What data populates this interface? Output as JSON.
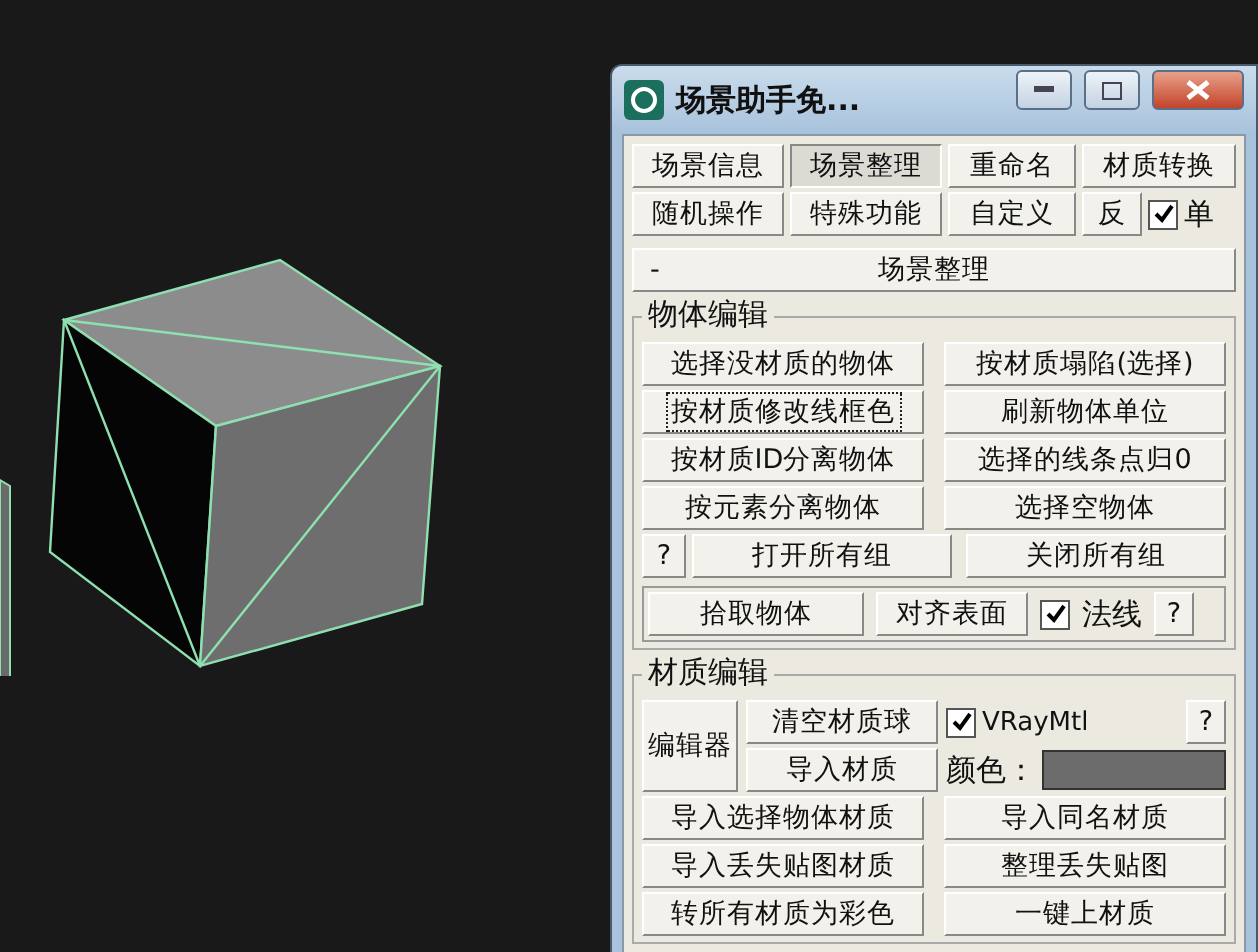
{
  "window": {
    "title": "场景助手免..."
  },
  "tabs": [
    {
      "label": "场景信息",
      "selected": false
    },
    {
      "label": "场景整理",
      "selected": true
    },
    {
      "label": "重命名",
      "selected": false
    },
    {
      "label": "材质转换",
      "selected": false
    },
    {
      "label": "随机操作",
      "selected": false
    },
    {
      "label": "特殊功能",
      "selected": false
    },
    {
      "label": "自定义",
      "selected": false
    }
  ],
  "invert_button": "反",
  "single_checkbox": {
    "label": "单",
    "checked": true
  },
  "rollout": {
    "toggle": "-",
    "title": "场景整理"
  },
  "object_edit": {
    "title": "物体编辑",
    "rows": [
      [
        {
          "label": "选择没材质的物体",
          "focused": false
        },
        {
          "label": "按材质塌陷(选择)",
          "focused": false
        }
      ],
      [
        {
          "label": "按材质修改线框色",
          "focused": true
        },
        {
          "label": "刷新物体单位",
          "focused": false
        }
      ],
      [
        {
          "label": "按材质ID分离物体",
          "focused": false
        },
        {
          "label": "选择的线条点归0",
          "focused": false
        }
      ],
      [
        {
          "label": "按元素分离物体",
          "focused": false
        },
        {
          "label": "选择空物体",
          "focused": false
        }
      ]
    ],
    "group_row": {
      "help": "?",
      "open_button": "打开所有组",
      "close_button": "关闭所有组"
    },
    "pick_button": "拾取物体",
    "align_button": "对齐表面",
    "normal_checkbox": {
      "label": "法线",
      "checked": true
    },
    "help": "?"
  },
  "material_edit": {
    "title": "材质编辑",
    "editor_button": "编辑器",
    "clear_button": "清空材质球",
    "import_button": "导入材质",
    "vray_checkbox": {
      "label": "VRayMtl",
      "checked": true
    },
    "help": "?",
    "color_label": "颜色：",
    "rows": [
      [
        "导入选择物体材质",
        "导入同名材质"
      ],
      [
        "导入丢失贴图材质",
        "整理丢失贴图"
      ],
      [
        "转所有材质为彩色",
        "一键上材质"
      ]
    ]
  }
}
